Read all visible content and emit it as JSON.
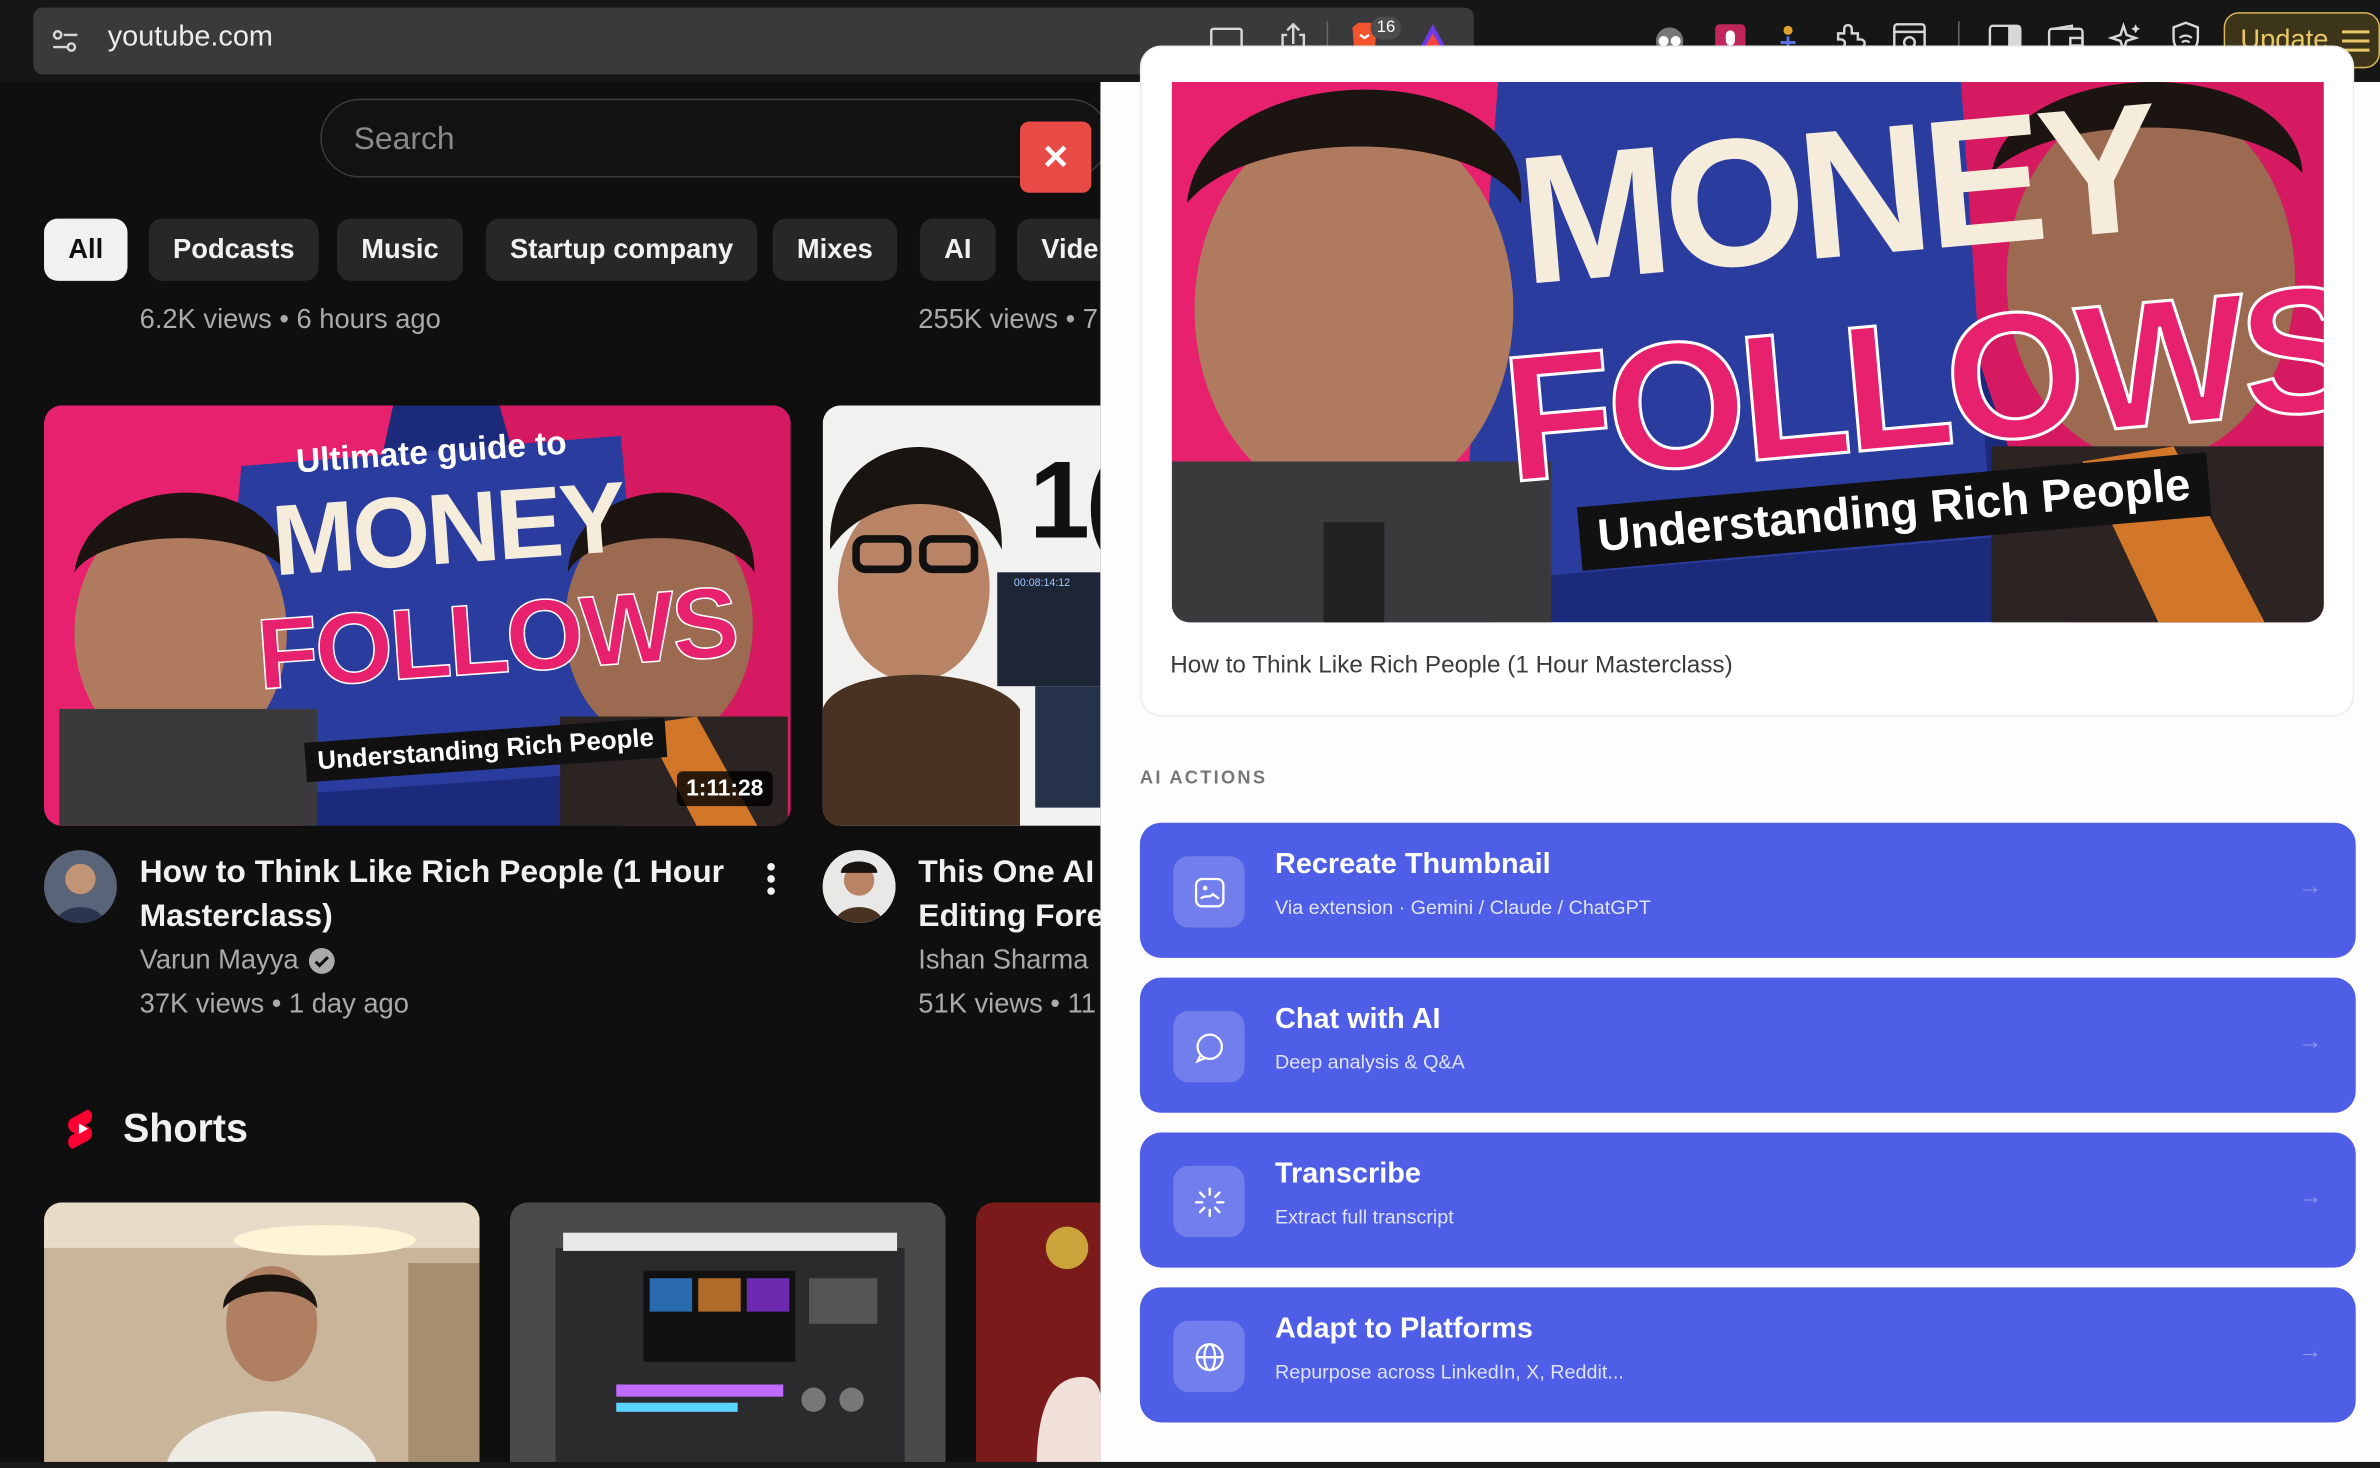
{
  "browser": {
    "url": "youtube.com",
    "brave_badge": "16",
    "update_label": "Update"
  },
  "youtube": {
    "search_placeholder": "Search",
    "chips": [
      "All",
      "Podcasts",
      "Music",
      "Startup company",
      "Mixes",
      "AI",
      "Vide"
    ],
    "prev_row_meta": [
      "6.2K views • 6 hours ago",
      "255K views • 7"
    ],
    "videos": [
      {
        "title_line1": "How to Think Like Rich People (1 Hour",
        "title_line2": "Masterclass)",
        "channel": "Varun Mayya",
        "stats": "37K views • 1 day ago",
        "duration": "1:11:28",
        "thumb_text": {
          "top": "Ultimate guide to",
          "line1": "MONEY",
          "line2": "FOLLOWS",
          "banner": "Understanding Rich People"
        }
      },
      {
        "title_line1": "This One AI T",
        "title_line2": "Editing Forev",
        "channel": "Ishan Sharma",
        "stats": "51K views • 11",
        "thumb_text": {
          "number": "1(",
          "timecode": "00:08:14:12"
        }
      }
    ],
    "shorts_label": "Shorts"
  },
  "panel": {
    "thumb_text": {
      "line1": "MONEY",
      "line2": "FOLLOWS",
      "banner": "Understanding Rich People"
    },
    "caption": "How to Think Like Rich People (1 Hour Masterclass)",
    "section_label": "AI ACTIONS",
    "actions": [
      {
        "title": "Recreate Thumbnail",
        "subtitle": "Via extension · Gemini / Claude / ChatGPT",
        "icon": "image-icon"
      },
      {
        "title": "Chat with AI",
        "subtitle": "Deep analysis & Q&A",
        "icon": "chat-icon"
      },
      {
        "title": "Transcribe",
        "subtitle": "Extract full transcript",
        "icon": "spinner-icon"
      },
      {
        "title": "Adapt to Platforms",
        "subtitle": "Repurpose across LinkedIn, X, Reddit...",
        "icon": "globe-icon"
      }
    ]
  },
  "colors": {
    "accent": "#4e5ee6",
    "youtube_bg": "#0f0f0f",
    "thumb_pink": "#e8216e",
    "thumb_navy": "#1b2a7a",
    "update": "#e8c767"
  }
}
